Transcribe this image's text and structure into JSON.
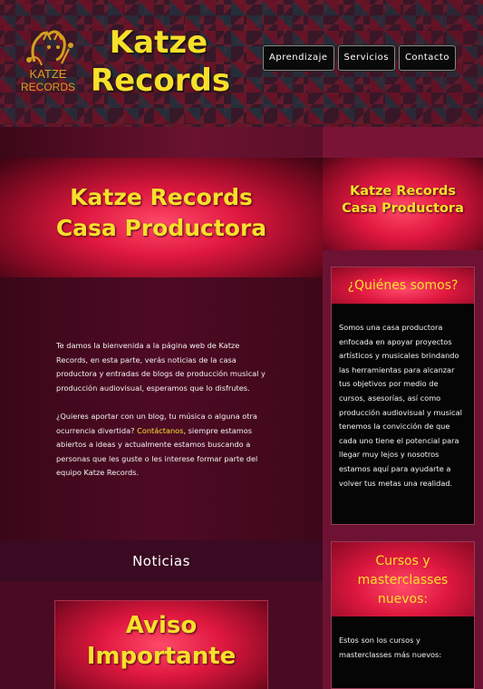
{
  "header": {
    "logo_text": [
      "KATZE",
      "RECORDS"
    ],
    "brand_title": "Katze Records",
    "nav": [
      {
        "label": "Aprendizaje"
      },
      {
        "label": "Servicios"
      },
      {
        "label": "Contacto"
      }
    ]
  },
  "hero": {
    "title_line1": "Katze Records",
    "title_line2": "Casa Productora"
  },
  "intro": {
    "p1": "Te damos la bienvenida a la página web de Katze Records, en esta parte, verás noticias de la casa productora y entradas de blogs de producción musical y producción audiovisual, esperamos que lo disfrutes.",
    "p2_before": "¿Quieres aportar con un blog, tu música o alguna otra ocurrencia divertida? ",
    "p2_link": "Contáctanos",
    "p2_after": ", siempre estamos abiertos a ideas y actualmente estamos buscando a personas que les guste o les interese formar parte del equipo Katze Records."
  },
  "news": {
    "bar_title": "Noticias",
    "card_title_line1": "Aviso",
    "card_title_line2": "Importante"
  },
  "sidebar": {
    "hero_line1": "Katze Records",
    "hero_line2": "Casa Productora",
    "about": {
      "title": "¿Quiénes somos?",
      "body": "Somos una casa productora enfocada en apoyar proyectos artísticos y musicales brindando las herramientas para alcanzar tus objetivos por medio de cursos, asesorías, así como producción audiovisual y musical tenemos la convicción de que cada uno tiene el potencial para llegar muy lejos y nosotros estamos aquí para ayudarte a volver tus metas una realidad."
    },
    "courses": {
      "title_line1": "Cursos y",
      "title_line2": "masterclasses",
      "title_line3": "nuevos:",
      "body": "Estos son los cursos y masterclasses más nuevos:"
    }
  },
  "colors": {
    "accent_yellow": "#f7e02b",
    "crimson": "#e0183f",
    "wine_background": "#5a0d26"
  }
}
